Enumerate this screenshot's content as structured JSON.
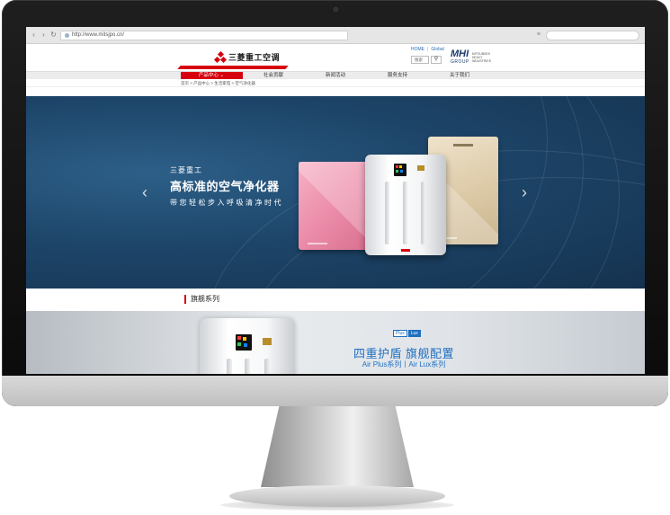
{
  "browser": {
    "url": "http://www.mitsjpo.cn/"
  },
  "header": {
    "logo_text": "三菱重工空调",
    "top_links": [
      "HOME",
      "Global"
    ],
    "search_input": "搜索",
    "search_button_icon": "magnifier-icon",
    "group_logo": "MHI",
    "group_label": "GROUP",
    "group_sub": "MITSUBISHI HEAVY INDUSTRIES"
  },
  "nav": {
    "items": [
      "产品中心 ⌄",
      "社会贡献",
      "新闻活动",
      "服务支持",
      "关于我们"
    ],
    "active_index": 0
  },
  "breadcrumb": {
    "text": "首页 > 产品中心 > 生活家电 > 空气净化器"
  },
  "hero": {
    "sub1": "三菱重工",
    "title": "高标准的空气净化器",
    "sub2": "带您轻松步入呼吸清净时代",
    "prev_icon": "chevron-left-icon",
    "next_icon": "chevron-right-icon"
  },
  "section": {
    "title": "旗舰系列"
  },
  "flagship": {
    "badge_plus": "Plus",
    "badge_lux": "Lux",
    "title": "四重护盾 旗舰配置",
    "subtitle": "Air Plus系列丨Air Lux系列"
  },
  "colors": {
    "brand_red": "#d7000f",
    "hero_blue": "#1d4569",
    "accent_blue": "#1f6fc1"
  }
}
